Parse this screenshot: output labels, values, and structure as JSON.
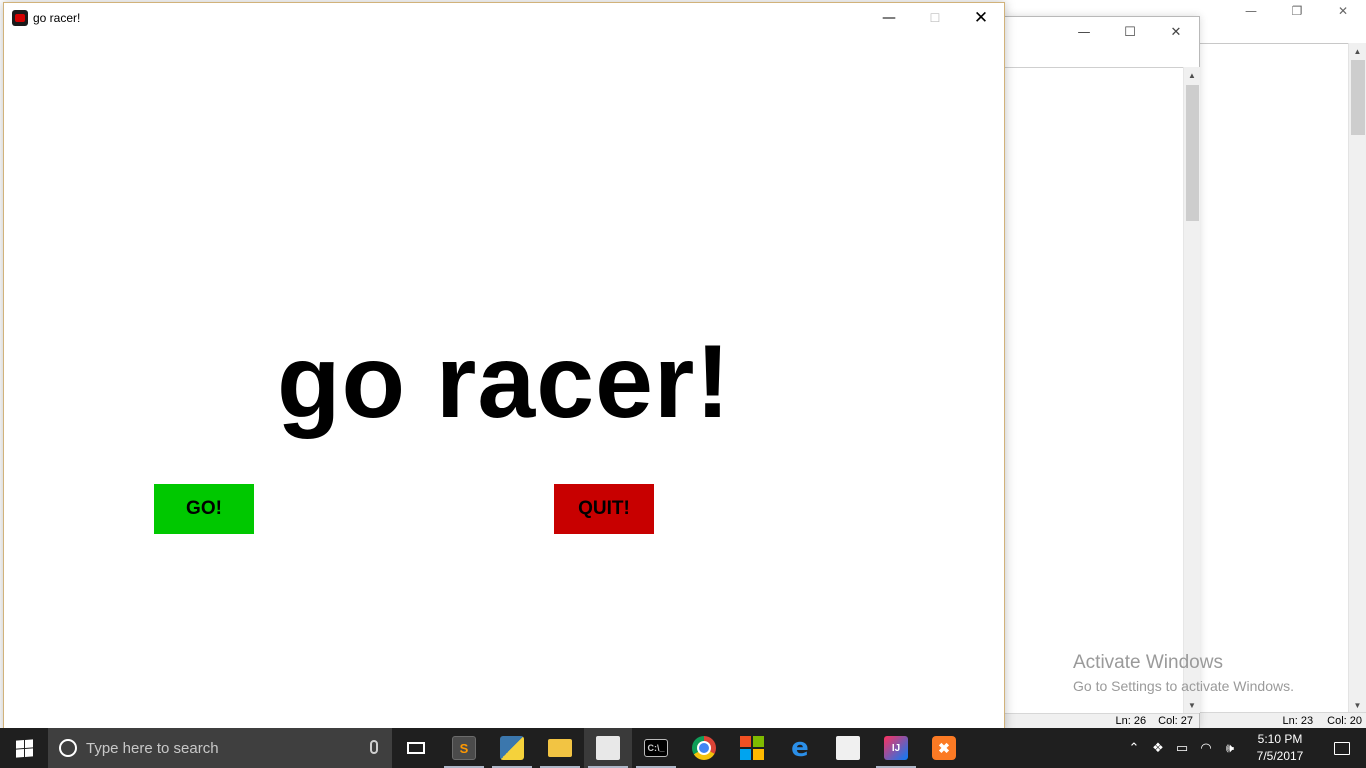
{
  "game_window": {
    "title": "go racer!",
    "heading": "go racer!",
    "go_button": "GO!",
    "quit_button": "QUIT!",
    "colors": {
      "go": "#00c800",
      "quit": "#c80000"
    }
  },
  "editor_window_1": {
    "status_ln": "Ln: 26",
    "status_col": "Col: 27"
  },
  "editor_window_2": {
    "status_ln": "Ln: 23",
    "status_col": "Col: 20"
  },
  "watermark": {
    "title": "Activate Windows",
    "subtitle": "Go to Settings to activate Windows."
  },
  "taskbar": {
    "search_placeholder": "Type here to search",
    "apps": [
      "sublime-text",
      "python-idle",
      "file-explorer",
      "python-file",
      "command-prompt",
      "chrome",
      "microsoft-store",
      "edge",
      "calculator",
      "intellij-idea",
      "xampp"
    ],
    "clock_time": "5:10 PM",
    "clock_date": "7/5/2017"
  }
}
